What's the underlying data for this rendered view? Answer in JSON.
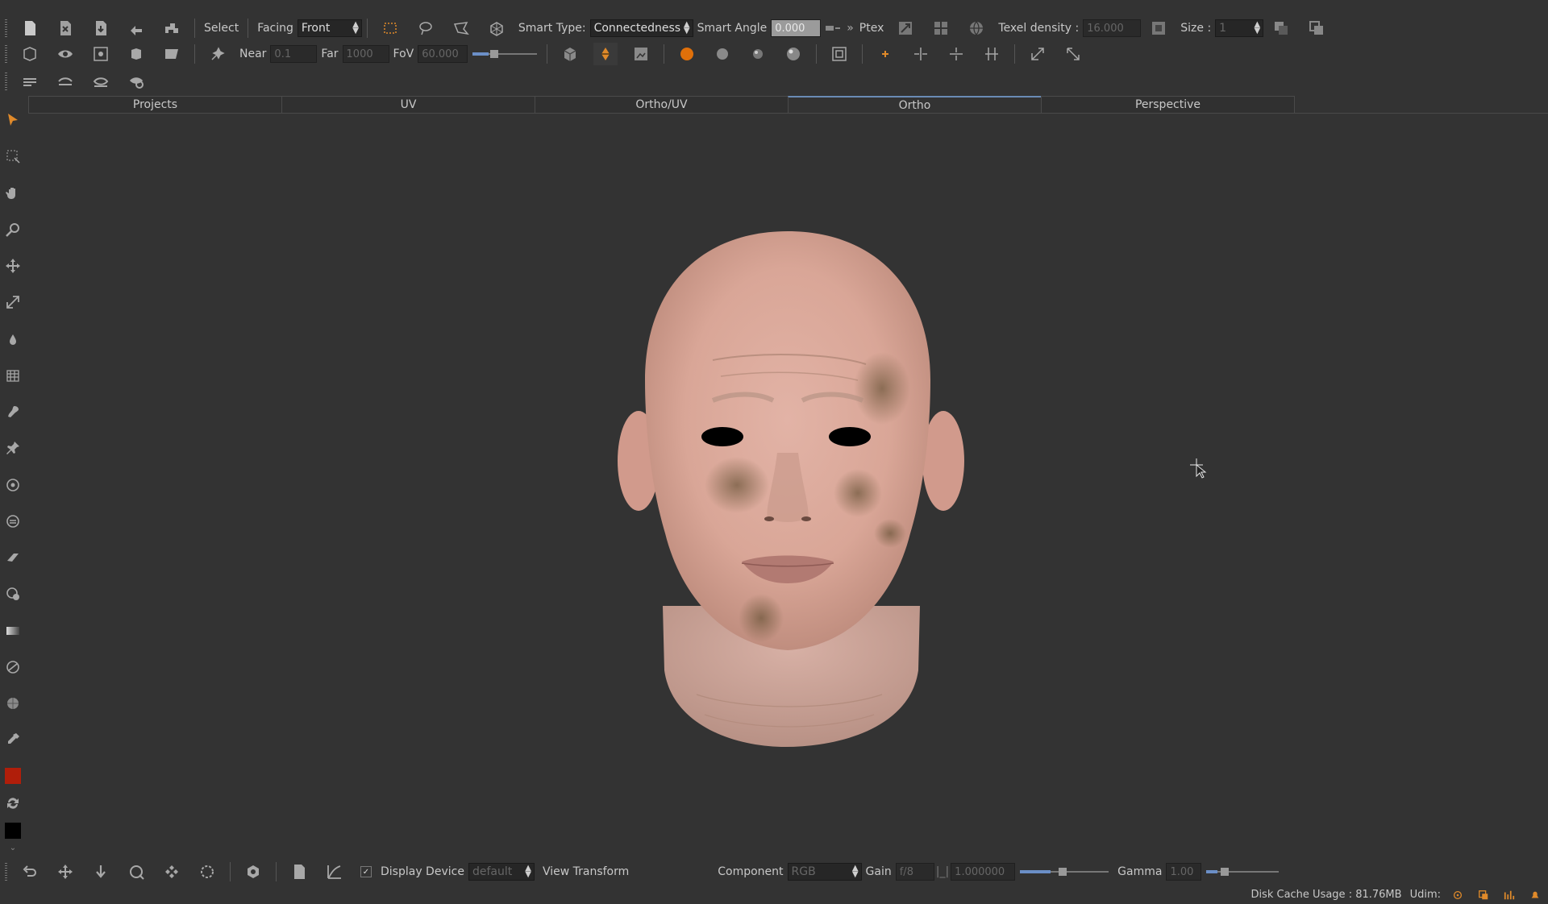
{
  "toolbar1": {
    "select_label": "Select",
    "facing_label": "Facing",
    "facing_value": "Front",
    "smart_type_label": "Smart Type:",
    "smart_type_value": "Connectedness",
    "smart_angle_label": "Smart Angle",
    "smart_angle_value": "0.000",
    "ptex_label": "Ptex",
    "texel_density_label": "Texel density :",
    "texel_density_value": "16.000",
    "size_label": "Size :",
    "size_value": "1"
  },
  "toolbar2": {
    "near_label": "Near",
    "near_value": "0.1",
    "far_label": "Far",
    "far_value": "1000",
    "fov_label": "FoV",
    "fov_value": "60.000"
  },
  "tabs": [
    {
      "label": "Projects",
      "active": false
    },
    {
      "label": "UV",
      "active": false
    },
    {
      "label": "Ortho/UV",
      "active": false
    },
    {
      "label": "Ortho",
      "active": true
    },
    {
      "label": "Perspective",
      "active": false
    }
  ],
  "bottombar": {
    "display_device_label": "Display Device",
    "display_device_value": "default",
    "view_transform_label": "View Transform",
    "component_label": "Component",
    "component_value": "RGB",
    "gain_label": "Gain",
    "gain_value": "f/8",
    "gain_number": "1.000000",
    "gamma_label": "Gamma",
    "gamma_value": "1.00"
  },
  "status": {
    "disk_cache": "Disk Cache Usage : 81.76MB",
    "udim_label": "Udim:"
  },
  "colors": {
    "foreground_swatch": "#b01e0a",
    "background_swatch": "#000000",
    "accent": "#e07a10"
  }
}
